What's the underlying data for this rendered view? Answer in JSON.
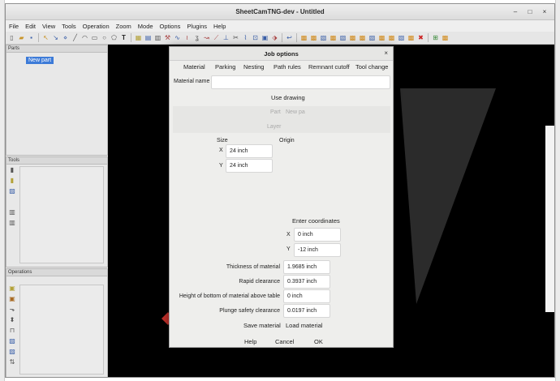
{
  "app": {
    "title": "SheetCamTNG-dev - Untitled",
    "menu": [
      "File",
      "Edit",
      "View",
      "Tools",
      "Operation",
      "Zoom",
      "Mode",
      "Options",
      "Plugins",
      "Help"
    ]
  },
  "panels": {
    "parts_title": "Parts",
    "parts_items": [
      "New part"
    ],
    "tools_title": "Tools",
    "operations_title": "Operations"
  },
  "dialog": {
    "title": "Job options",
    "close": "×",
    "tabs": [
      "Material",
      "Parking",
      "Nesting",
      "Path rules",
      "Remnant cutoff",
      "Tool change"
    ],
    "material_name_label": "Material name",
    "material_name_value": "",
    "use_drawing": "Use drawing",
    "part_label": "Part",
    "part_value": "New pa",
    "layer_label": "Layer",
    "size_label": "Size",
    "origin_label": "Origin",
    "size_x_label": "X",
    "size_x_value": "24 inch",
    "size_y_label": "Y",
    "size_y_value": "24 inch",
    "enter_coordinates": "Enter coordinates",
    "coord_x_label": "X",
    "coord_x_value": "0 inch",
    "coord_y_label": "Y",
    "coord_y_value": "-12 inch",
    "thickness_label": "Thickness of material",
    "thickness_value": "1.9685 inch",
    "rapid_label": "Rapid clearance",
    "rapid_value": "0.3937 inch",
    "bottom_label": "Height of bottom of material above table",
    "bottom_value": "0 inch",
    "plunge_label": "Plunge safety clearance",
    "plunge_value": "0.0197 inch",
    "save_material": "Save material",
    "load_material": "Load material",
    "help": "Help",
    "cancel": "Cancel",
    "ok": "OK"
  }
}
